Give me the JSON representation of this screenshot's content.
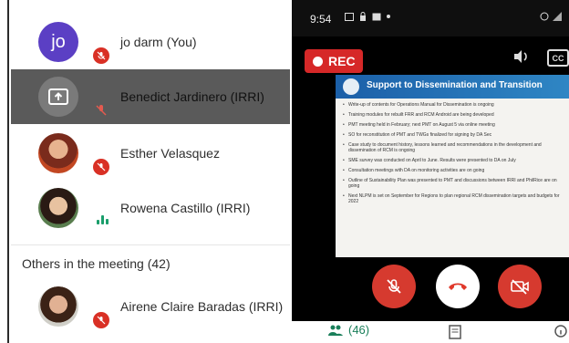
{
  "participants": [
    {
      "name": "jo darm (You)",
      "avatar_letter": "jo"
    },
    {
      "name": "Benedict Jardinero (IRRI)"
    },
    {
      "name": "Esther Velasquez"
    },
    {
      "name": "Rowena Castillo (IRRI)"
    }
  ],
  "others_header": "Others in the meeting (42)",
  "others": [
    {
      "name": "Airene Claire Baradas (IRRI)"
    }
  ],
  "status_bar": {
    "time": "9:54"
  },
  "recording": {
    "label": "REC"
  },
  "captions": {
    "label": "CC"
  },
  "slide": {
    "title": "Support to Dissemination and Transition",
    "bullets": [
      "Write-up of contents for Operations Manual for Dissemination is ongoing",
      "Training modules for rebuilt FRR and RCM Android are being developed",
      "PMT meeting held in February; next PMT on August 5 via online meeting",
      "SO for reconstitution of PMT and TWGs finalized for signing by DA Sec",
      "Case study to document history, lessons learned and recommendations in the development and dissemination of RCM is ongoing",
      "SME survey was conducted on April to June. Results were presented to DA on July",
      "Consultation meetings with DA on monitoring activities are on going",
      "Outline of Sustainability Plan was presented to PMT and discussions between IRRI and PhilRice are on going",
      "Next NLPM is set on September for Regions to plan regional RCM dissemination targets and budgets for 2022"
    ]
  },
  "bottom_bar": {
    "people_count": "(46)"
  },
  "colors": {
    "mute_red": "#d93025",
    "jo_avatar": "#5b3fc4",
    "speaking_green": "#1a9e6b",
    "rec_red": "#d62828"
  }
}
